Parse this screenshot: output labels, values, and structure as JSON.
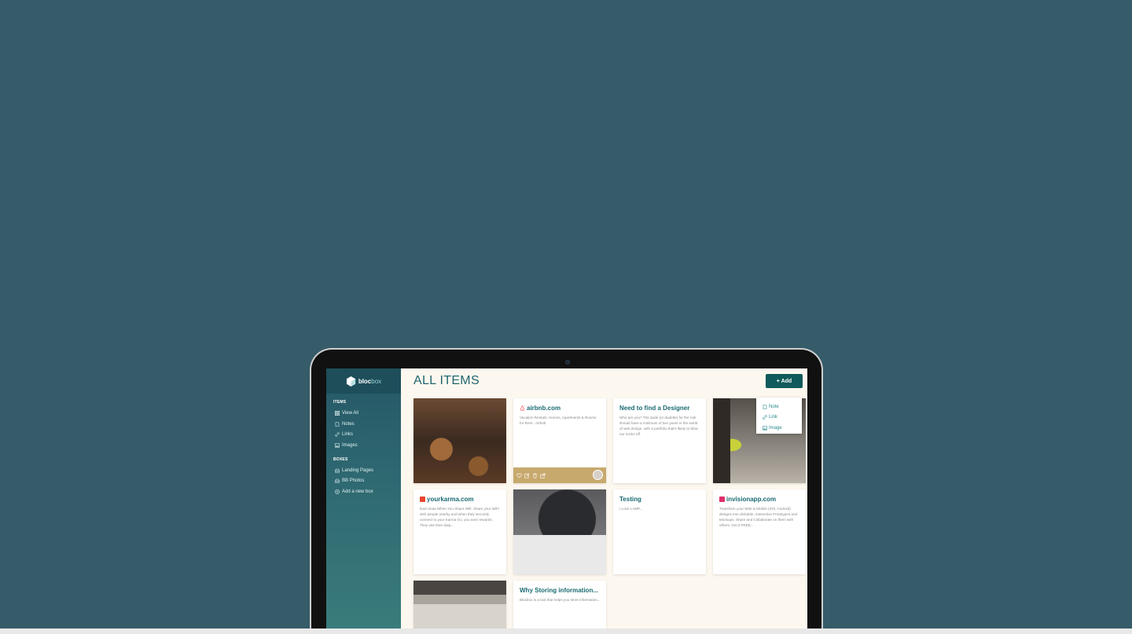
{
  "app": {
    "logo_name": "bloc",
    "logo_suffix": "box"
  },
  "sidebar": {
    "items_heading": "ITEMS",
    "items": [
      {
        "label": "View All",
        "icon": "grid-icon"
      },
      {
        "label": "Notes",
        "icon": "note-icon"
      },
      {
        "label": "Links",
        "icon": "link-icon"
      },
      {
        "label": "Images",
        "icon": "image-icon"
      }
    ],
    "boxes_heading": "BOXES",
    "boxes": [
      {
        "label": "Landing Pages",
        "icon": "box-icon"
      },
      {
        "label": "BB Photos",
        "icon": "box-icon"
      },
      {
        "label": "Add a new box",
        "icon": "plus-circle-icon"
      }
    ]
  },
  "main": {
    "title": "ALL ITEMS",
    "add_button": "+ Add",
    "add_menu": [
      {
        "label": "Note",
        "icon": "note-icon"
      },
      {
        "label": "Link",
        "icon": "link-icon"
      },
      {
        "label": "Image",
        "icon": "image-icon"
      }
    ]
  },
  "cards": {
    "airbnb": {
      "title": "airbnb.com",
      "desc": "Vacation Rentals, Homes, Apartments & Rooms for Rent - Airbnb"
    },
    "designer": {
      "title": "Need to find a Designer",
      "desc": "Who are you? The dude (or dudette) for the role should have a minimum of two years in the world of web design, with a portfolio that's likely to blow our socks off."
    },
    "yourkarma": {
      "title": "yourkarma.com",
      "desc": "Earn Data When You Share Wifi. Share your WiFi with people nearby and when they securely connect to your Karma Go, you earn rewards. They use their data..."
    },
    "testing": {
      "title": "Testing",
      "desc": "I Love LAMP..."
    },
    "invision": {
      "title": "invisionapp.com",
      "desc": "Transform your Web & Mobile (iOS, Android) designs into clickable, interactive Prototypes and Mockups. Share and Collaborate on them with others. Get it FREE..."
    },
    "storing": {
      "title": "Why Storing information...",
      "desc": "Blocbox is a tool that helps you store information..."
    }
  },
  "colors": {
    "background": "#365c69",
    "accent": "#1b6a73",
    "button": "#0f5a5c",
    "airbnb": "#ff5a5f",
    "karma": "#e8462e",
    "invision": "#e0306b"
  }
}
